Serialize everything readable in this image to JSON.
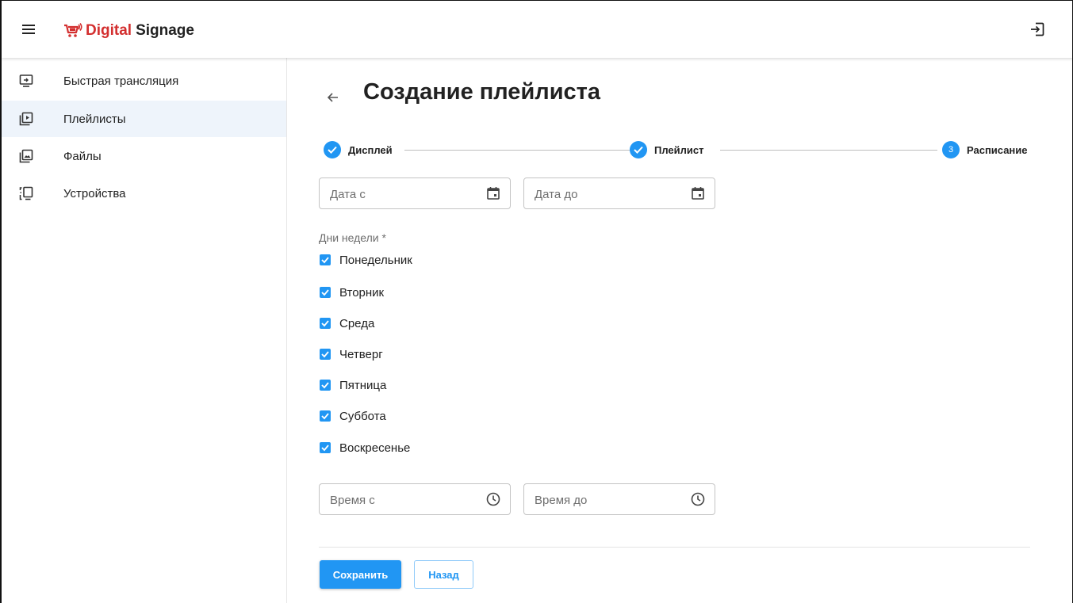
{
  "header": {
    "logo_text_red": "Digital",
    "logo_text_dark": "Signage",
    "menu_icon": "hamburger-menu-icon",
    "exit_icon": "logout-icon"
  },
  "sidebar": {
    "items": [
      {
        "label": "Быстрая трансляция",
        "icon": "screen-share-icon",
        "active": false
      },
      {
        "label": "Плейлисты",
        "icon": "playlist-play-icon",
        "active": true
      },
      {
        "label": "Файлы",
        "icon": "image-file-icon",
        "active": false
      },
      {
        "label": "Устройства",
        "icon": "devices-icon",
        "active": false
      }
    ]
  },
  "main": {
    "title": "Создание плейлиста",
    "stepper": {
      "steps": [
        {
          "label": "Дисплей",
          "state": "done"
        },
        {
          "label": "Плейлист",
          "state": "done"
        },
        {
          "label": "Расписание",
          "state": "active",
          "number": "3"
        }
      ]
    },
    "date_from": {
      "placeholder": "Дата с",
      "value": ""
    },
    "date_to": {
      "placeholder": "Дата до",
      "value": ""
    },
    "days_label": "Дни недели *",
    "days": [
      {
        "label": "Понедельник",
        "checked": true
      },
      {
        "label": "Вторник",
        "checked": true
      },
      {
        "label": "Среда",
        "checked": true
      },
      {
        "label": "Четверг",
        "checked": true
      },
      {
        "label": "Пятница",
        "checked": true
      },
      {
        "label": "Суббота",
        "checked": true
      },
      {
        "label": "Воскресенье",
        "checked": true
      }
    ],
    "time_from": {
      "placeholder": "Время с",
      "value": ""
    },
    "time_to": {
      "placeholder": "Время до",
      "value": ""
    },
    "save_label": "Сохранить",
    "back_label": "Назад"
  },
  "colors": {
    "accent": "#2196f3",
    "brand_red": "#d32f2f",
    "active_nav_bg": "#eef4fb"
  }
}
